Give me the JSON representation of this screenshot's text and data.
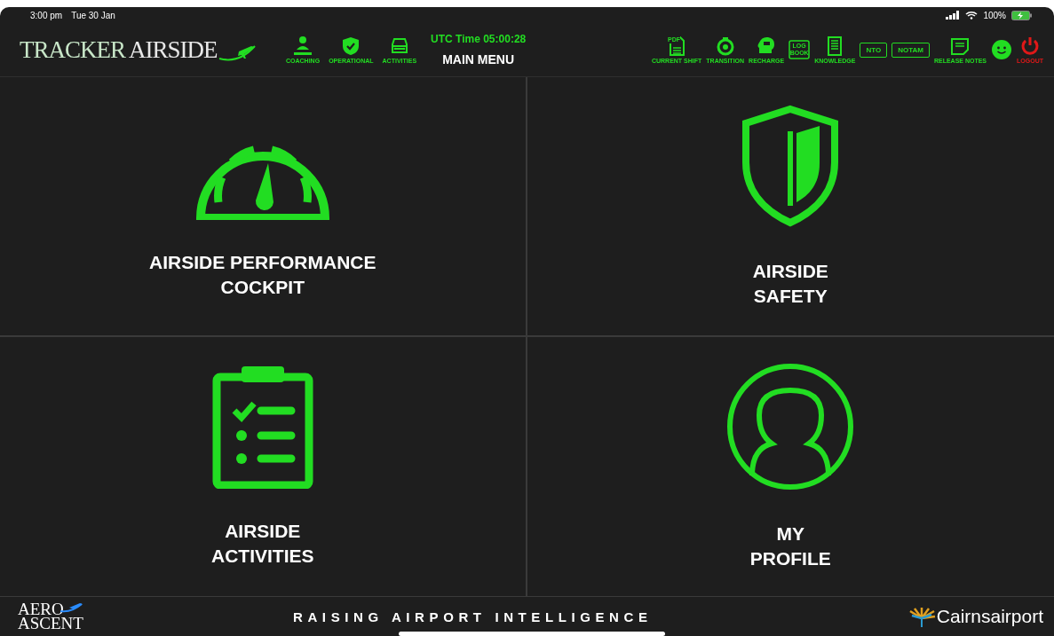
{
  "status_bar": {
    "time": "3:00 pm",
    "date": "Tue 30 Jan",
    "battery": "100%"
  },
  "header": {
    "logo": [
      "TRACKER",
      "AIRSIDE"
    ],
    "utc_time": "UTC Time 05:00:28",
    "title": "MAIN MENU",
    "left_tools": [
      {
        "kind": "coaching",
        "label": "COACHING"
      },
      {
        "kind": "operational",
        "label": "OPERATIONAL"
      },
      {
        "kind": "activities",
        "label": "ACTIVITIES"
      }
    ],
    "right_tools": [
      {
        "kind": "pdf",
        "label": "CURRENT SHIFT",
        "icon_text": "PDF"
      },
      {
        "kind": "transition",
        "label": "TRANSITION"
      },
      {
        "kind": "recharge",
        "label": "RECHARGE"
      },
      {
        "kind": "logbook",
        "icon_text": "LOG BOOK"
      },
      {
        "kind": "knowledge",
        "label": "KNOWLEDGE"
      },
      {
        "kind": "boxed",
        "icon_text": "NTO"
      },
      {
        "kind": "boxed",
        "icon_text": "NOTAM"
      },
      {
        "kind": "notes",
        "label": "RELEASE NOTES"
      },
      {
        "kind": "smiley"
      },
      {
        "kind": "logout",
        "label": "LOGOUT"
      }
    ]
  },
  "tiles": [
    {
      "kind": "gauge",
      "lines": [
        "AIRSIDE PERFORMANCE",
        "COCKPIT"
      ]
    },
    {
      "kind": "shield",
      "lines": [
        "AIRSIDE",
        "SAFETY"
      ]
    },
    {
      "kind": "clipboard",
      "lines": [
        "AIRSIDE",
        "ACTIVITIES"
      ]
    },
    {
      "kind": "profile",
      "lines": [
        "MY",
        "PROFILE"
      ]
    }
  ],
  "footer": {
    "brand": [
      "AERO",
      "ASCENT"
    ],
    "tagline": "RAISING AIRPORT INTELLIGENCE",
    "partner": "Cairnsairport"
  }
}
